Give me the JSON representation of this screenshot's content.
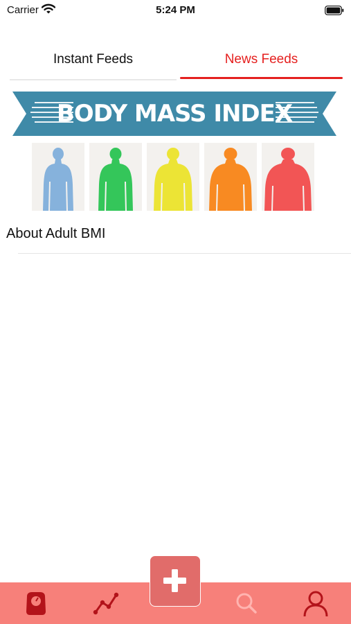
{
  "status_bar": {
    "carrier": "Carrier",
    "time": "5:24 PM",
    "wifi_icon": "wifi-icon",
    "battery_icon": "battery-icon"
  },
  "tabs": [
    {
      "label": "Instant Feeds",
      "active": false
    },
    {
      "label": "News Feeds",
      "active": true
    }
  ],
  "colors": {
    "accent": "#e5201f",
    "tab_bar": "#f7807a",
    "add_button": "#e16c6a",
    "tab_icon_active": "#b3131a",
    "ribbon": "#3f8aa8"
  },
  "news": {
    "banner_title": "BODY MASS INDEX",
    "banner_figure_colors": [
      "#86b2dc",
      "#34c65a",
      "#ece435",
      "#f88a22",
      "#f25555"
    ],
    "items": [
      {
        "title": "About Adult BMI"
      }
    ]
  },
  "bottom_bar": {
    "items": [
      {
        "icon": "scale-icon"
      },
      {
        "icon": "chart-line-icon"
      },
      {
        "icon": "plus-icon"
      },
      {
        "icon": "search-icon"
      },
      {
        "icon": "user-icon"
      }
    ]
  }
}
